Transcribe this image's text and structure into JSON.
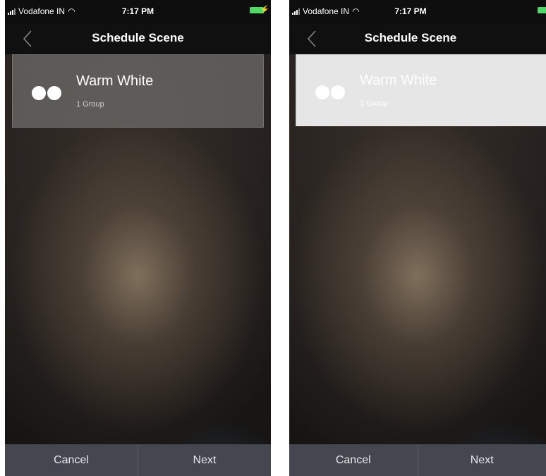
{
  "screens": [
    {
      "status": {
        "carrier": "Vodafone IN",
        "time": "7:17 PM"
      },
      "nav": {
        "title": "Schedule Scene"
      },
      "scene": {
        "name": "Warm White",
        "subtitle": "1 Group",
        "state": "default"
      },
      "footer": {
        "cancel": "Cancel",
        "next": "Next"
      }
    },
    {
      "status": {
        "carrier": "Vodafone IN",
        "time": "7:17 PM"
      },
      "nav": {
        "title": "Schedule Scene"
      },
      "scene": {
        "name": "Warm White",
        "subtitle": "1 Group",
        "state": "selected"
      },
      "footer": {
        "cancel": "Cancel",
        "next": "Next"
      }
    }
  ],
  "colors": {
    "battery": "#4cd964",
    "selected_card": "#e6e6e6",
    "footer": "#444650"
  },
  "icons": {
    "back": "chevron-left-icon",
    "scene": "two-dots-icon",
    "wifi": "wifi-icon",
    "signal": "signal-icon",
    "battery": "battery-icon"
  }
}
